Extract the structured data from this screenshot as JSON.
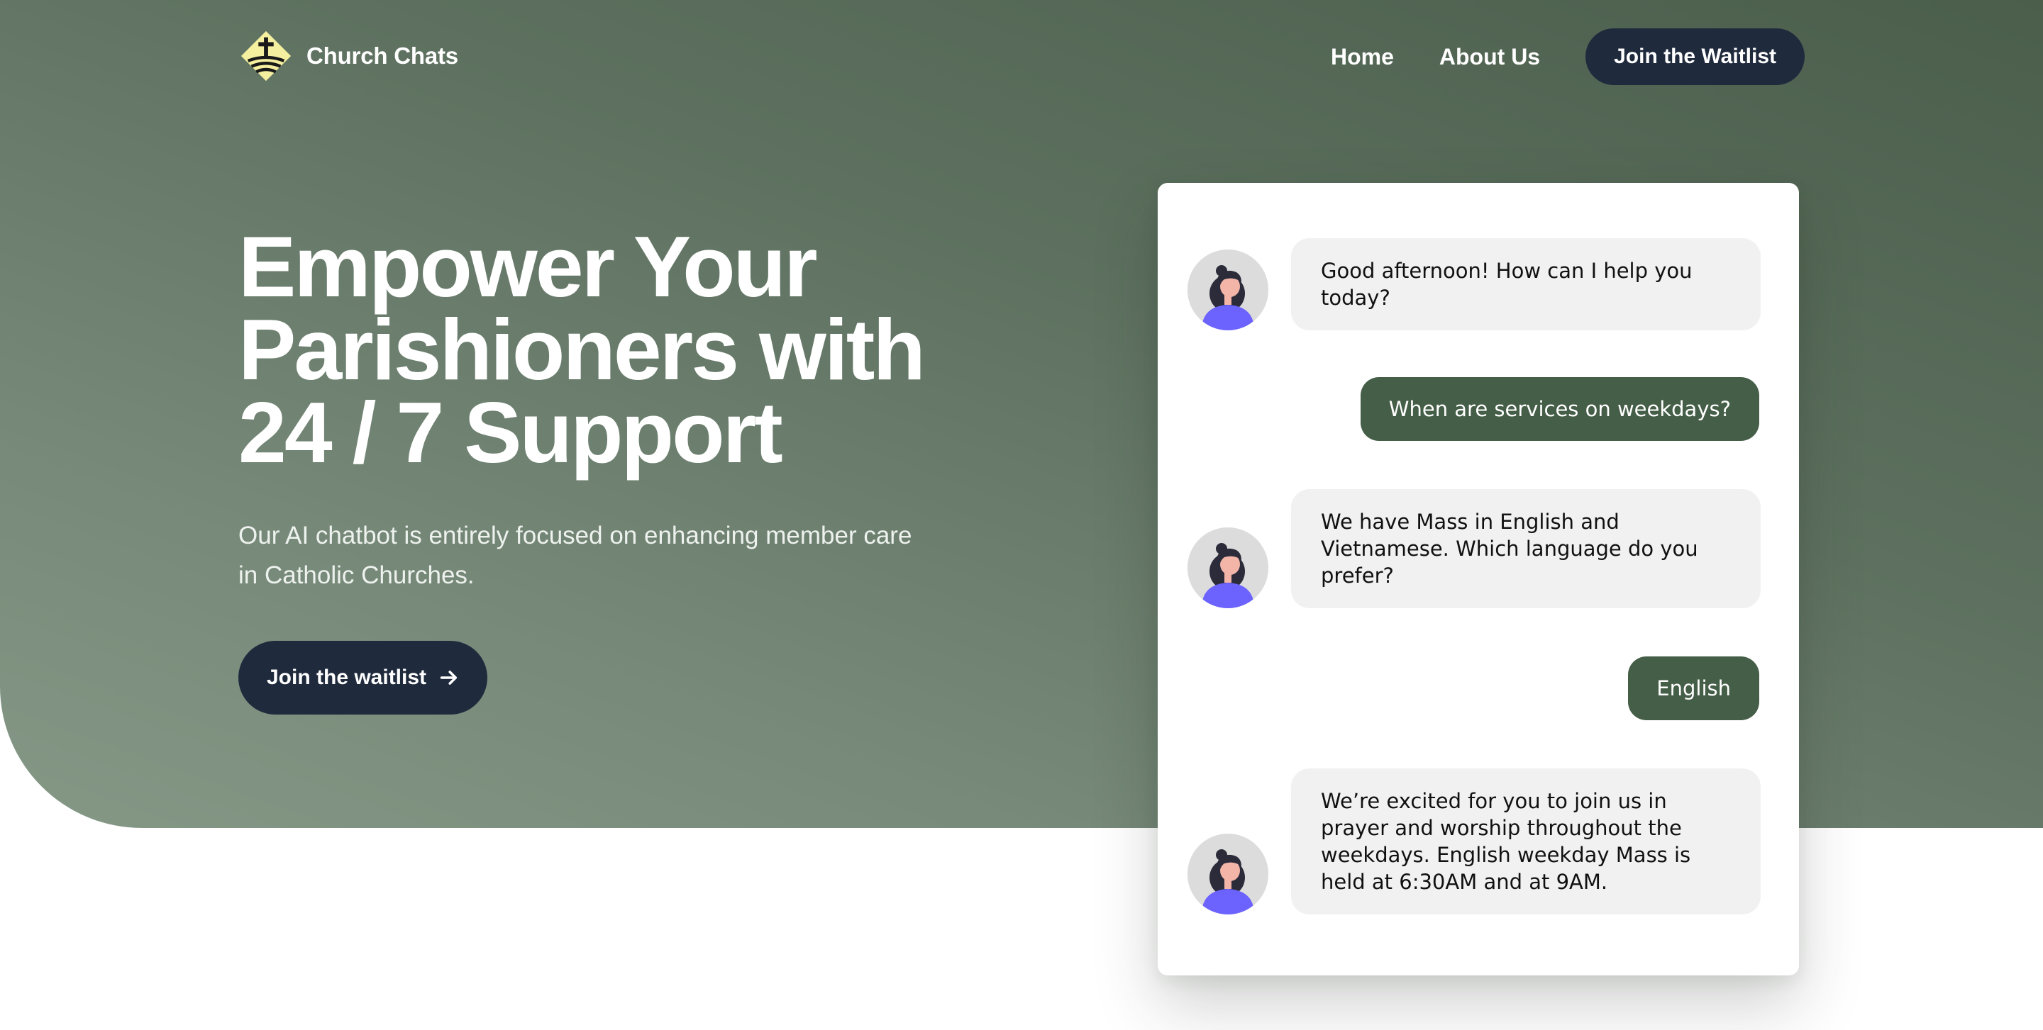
{
  "brand": {
    "name": "Church Chats",
    "logo_icon": "cross-diamond-logo",
    "colors": {
      "hero_green": "#5e7160",
      "navy": "#1f2a3d",
      "user_bubble": "#455e47",
      "bot_bubble": "#f1f1f1",
      "logo_yellow": "#f5f0a0"
    }
  },
  "nav": {
    "home": "Home",
    "about": "About Us",
    "cta": "Join the Waitlist"
  },
  "hero": {
    "headline": "Empower Your Parishioners with 24 / 7 Support",
    "subtitle": "Our AI chatbot is entirely focused on enhancing member care in Catholic Churches.",
    "cta_label": "Join the waitlist",
    "cta_icon": "arrow-right-icon"
  },
  "chat": {
    "messages": [
      {
        "from": "bot",
        "text": "Good afternoon! How can I help you today?"
      },
      {
        "from": "user",
        "text": "When are services on weekdays?"
      },
      {
        "from": "bot",
        "text": "We have Mass in English and Vietnamese. Which language do you prefer?"
      },
      {
        "from": "user",
        "text": "English"
      },
      {
        "from": "bot",
        "text": "We’re excited for you to join us in prayer and worship throughout the weekdays. English weekday Mass is held at 6:30AM and at 9AM."
      }
    ]
  }
}
